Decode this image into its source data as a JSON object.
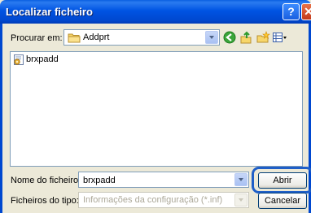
{
  "window": {
    "title": "Localizar ficheiro",
    "help_glyph": "?",
    "close_glyph": "✕"
  },
  "lookin": {
    "label": "Procurar em:",
    "value": "Addprt",
    "icon": "folder-icon"
  },
  "toolbar": {
    "icons": [
      "back-icon",
      "up-folder-icon",
      "new-folder-icon",
      "view-menu-icon"
    ]
  },
  "file_list": {
    "items": [
      {
        "name": "brxpadd",
        "icon": "setup-file-icon"
      }
    ]
  },
  "filename": {
    "label": "Nome do ficheiro:",
    "value": "brxpadd"
  },
  "filetype": {
    "label": "Ficheiros do tipo:",
    "value": "Informações da configuração (*.inf)"
  },
  "buttons": {
    "open": "Abrir",
    "cancel": "Cancelar"
  },
  "colors": {
    "title_bar": "#0054e3",
    "dialog_bg": "#ece9d8",
    "highlight": "#1f5fc8"
  }
}
